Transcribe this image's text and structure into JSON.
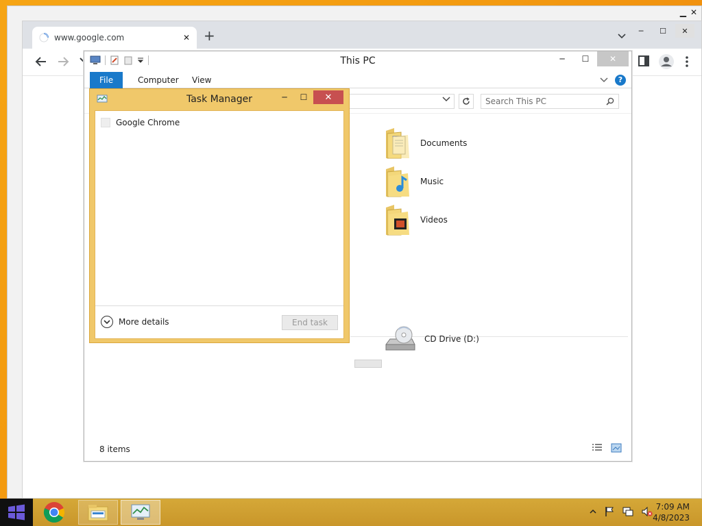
{
  "background_window": {
    "edge_label": "M"
  },
  "chrome": {
    "tab_title": "www.google.com",
    "new_tab_symbol": "+"
  },
  "explorer": {
    "title": "This PC",
    "ribbon_tabs": {
      "file": "File",
      "computer": "Computer",
      "view": "View"
    },
    "search_placeholder": "Search This PC",
    "items": [
      {
        "name": "Documents",
        "icon": "documents-folder-icon"
      },
      {
        "name": "Music",
        "icon": "music-folder-icon"
      },
      {
        "name": "Videos",
        "icon": "videos-folder-icon"
      }
    ],
    "drive": {
      "name": "CD Drive (D:)",
      "icon": "cd-drive-icon"
    },
    "status": "8 items"
  },
  "task_manager": {
    "title": "Task Manager",
    "processes": [
      {
        "name": "Google Chrome"
      }
    ],
    "more_details": "More details",
    "end_task": "End task"
  },
  "taskbar": {
    "time": "7:09 AM",
    "date": "4/8/2023",
    "apps": [
      "chrome-icon",
      "file-explorer-icon",
      "task-manager-icon"
    ]
  },
  "colors": {
    "desktop": "#f39a10",
    "task_manager_frame": "#f0c86a",
    "ribbon_file": "#1979ca",
    "close_red": "#c75050"
  }
}
